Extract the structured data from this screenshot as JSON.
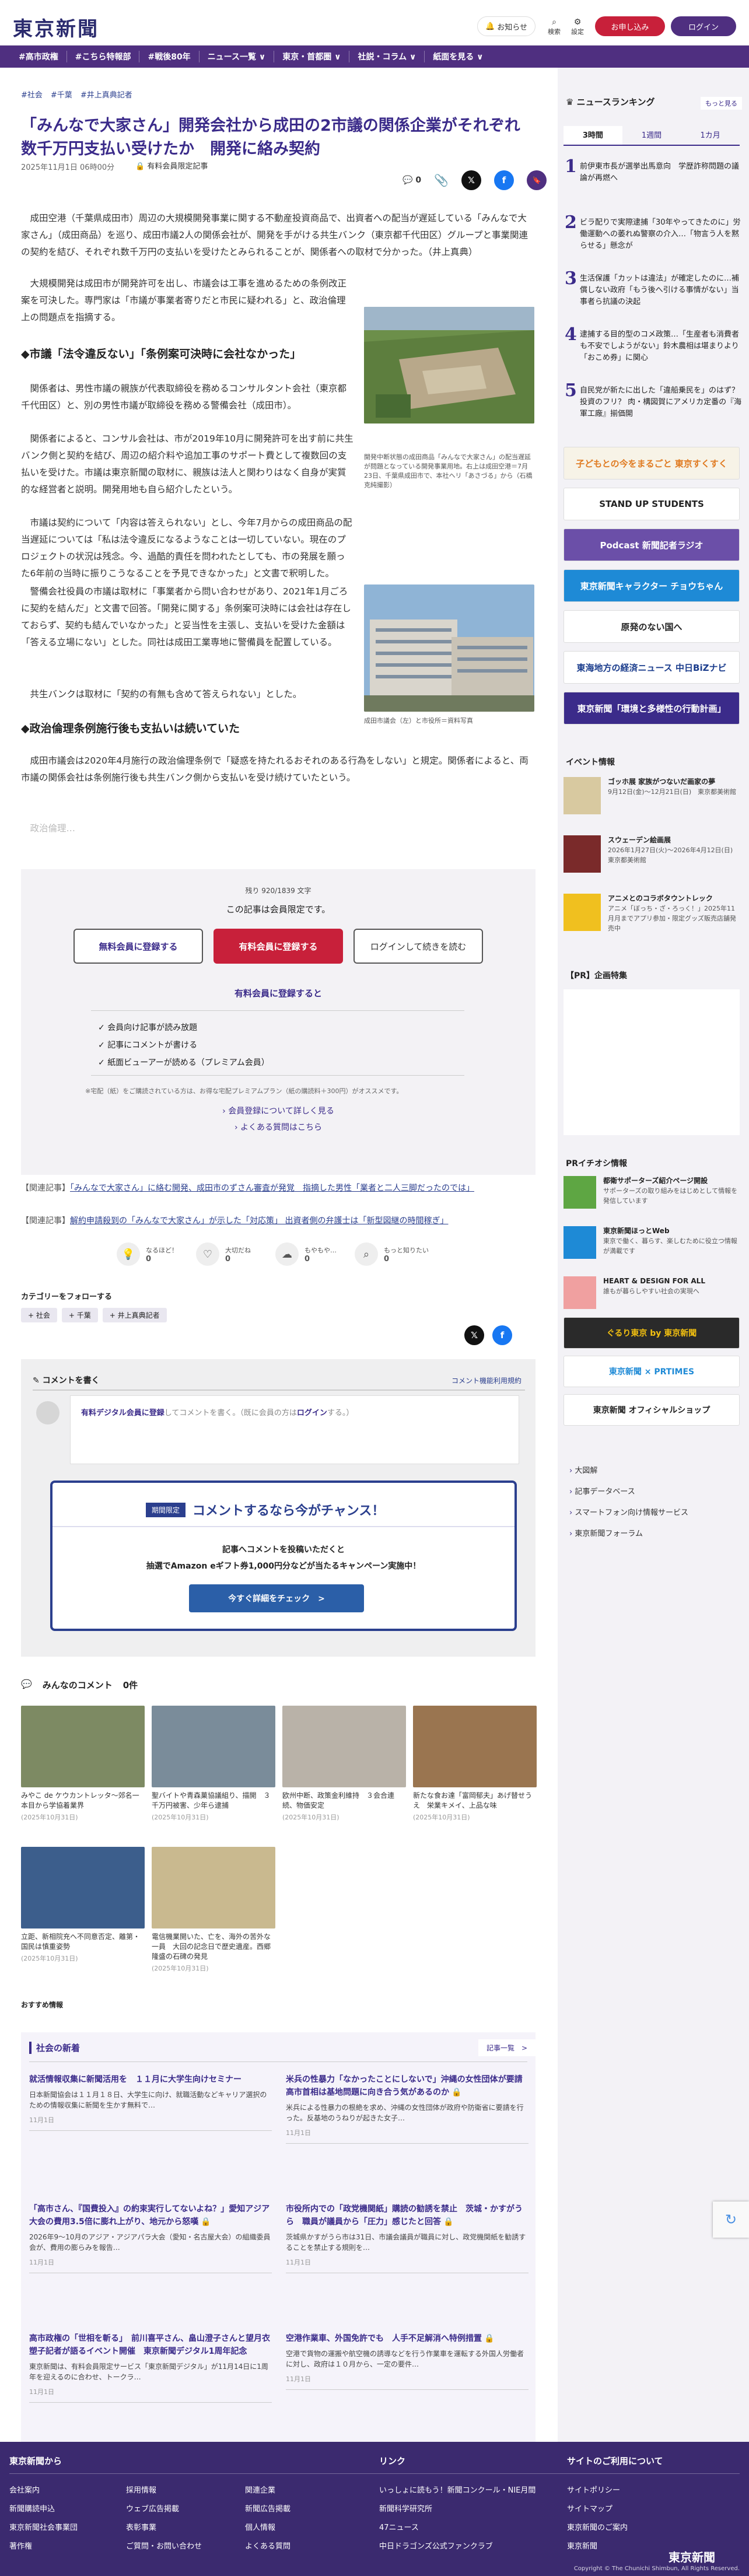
{
  "header": {
    "logo": "東京新聞",
    "notify_label": "お知らせ",
    "search_label": "検索",
    "settings_label": "設定",
    "subscribe_label": "お申し込み",
    "login_label": "ログイン"
  },
  "nav": [
    "#高市政権",
    "#こちら特報部",
    "#戦後80年",
    "ニュース一覧 ∨",
    "東京・首都圏 ∨",
    "社説・コラム ∨",
    "紙面を見る ∨"
  ],
  "article": {
    "tags": [
      "#社会",
      "#千葉",
      "#井上真典記者"
    ],
    "title": "「みんなで大家さん」開発会社から成田の2市議の関係企業がそれぞれ数千万円支払い受けたか　開発に絡み契約",
    "date": "2025年11月1日 06時00分",
    "paid_badge": "有料会員限定記事",
    "comment_count": "0",
    "p1": "成田空港（千葉県成田市）周辺の大規模開発事業に関する不動産投資商品で、出資者への配当が遅延している「みんなで大家さん」（成田商品）を巡り、成田市議2人の関係会社が、開発を手がける共生バンク（東京都千代田区）グループと事業関連の契約を結び、それぞれ数千万円の支払いを受けたとみられることが、関係者への取材で分かった。（井上真典）",
    "p2": "大規模開発は成田市が開発許可を出し、市議会は工事を進めるための条例改正案を可決した。専門家は「市議が事業者寄りだと市民に疑われる」と、政治倫理上の問題点を指摘する。",
    "sub1": "◆市議「法令違反ない」「条例案可決時に会社なかった」",
    "p3": "関係者は、男性市議の親族が代表取締役を務めるコンサルタント会社（東京都千代田区）と、別の男性市議が取締役を務める警備会社（成田市）。",
    "p4": "関係者によると、コンサル会社は、市が2019年10月に開発許可を出す前に共生バンク側と契約を結び、周辺の紹介料や追加工事のサポート費として複数回の支払いを受けた。市議は東京新聞の取材に、親族は法人と関わりはなく自身が実質的な経営者と説明。開発用地も自ら紹介したという。",
    "p5": "市議は契約について「内容は答えられない」とし、今年7月からの成田商品の配当遅延については「私は法令違反になるようなことは一切していない。現在のプロジェクトの状況は残念。今、過酷的責任を問われたとしても、市の発展を願った6年前の当時に振りこうなることを予見できなかった」と文書で釈明した。",
    "p6": "警備会社役員の市議は取材に「事業者から問い合わせがあり、2021年1月ごろに契約を結んだ」と文書で回答。「開発に関する」条例案可決時には会社は存在しておらず、契約も結んでいなかった」と妥当性を主張し、支払いを受けた金額は「答える立場にない」とした。同社は成田工業専地に警備員を配置している。",
    "p7": "共生バンクは取材に「契約の有無も含めて答えられない」とした。",
    "sub2": "◆政治倫理条例施行後も支払いは続いていた",
    "p8": "成田市議会は2020年4月施行の政治倫理条例で「疑惑を持たれるおそれのある行為をしない」と規定。関係者によると、両市議の関係会社は条例施行後も共生バンク側から支払いを受け続けていたという。",
    "fade": "政治倫理…",
    "photo1_caption": "開発中断状態の成田商品「みんなで大家さん」の配当遅延が問題となっている開発事業用地。右上は成田空港＝7月23日、千葉県成田市で、本社ヘリ「あさづる」から（石橋克純撮影）",
    "photo2_caption": "成田市議会（左）と市役所＝資料写真"
  },
  "paywall": {
    "remaining": "残り 920/1839 文字",
    "heading": "この記事は会員限定です。",
    "btn_free": "無料会員に登録する",
    "btn_paid": "有料会員に登録する",
    "btn_login": "ログインして続きを読む",
    "benefits_title": "有料会員に登録すると",
    "benefits": [
      "会員向け記事が読み放題",
      "記事にコメントが書ける",
      "紙面ビューアーが読める（プレミアム会員）"
    ],
    "note": "※宅配（紙）をご購読されている方は、お得な宅配プレミアムプラン（紙の購読料＋300円）がオススメです。",
    "link1": "会員登録について詳しく見る",
    "link2": "よくある質問はこちら"
  },
  "related": [
    {
      "label": "【関連記事】",
      "text": "「みんなで大家さん」に絡む開発、成田市のずさん審査が発覚　指摘した男性「業者と二人三脚だったのでは」"
    },
    {
      "label": "【関連記事】",
      "text": "解約申請殺到の「みんなで大家さん」が示した「対応策」 出資者側の弁護士は「新型図継の時間稼ぎ」"
    }
  ],
  "reactions": [
    {
      "label": "なるほど！",
      "count": "0"
    },
    {
      "label": "大切だね",
      "count": "0"
    },
    {
      "label": "もやもや…",
      "count": "0"
    },
    {
      "label": "もっと知りたい",
      "count": "0"
    }
  ],
  "categories": {
    "title": "カテゴリーをフォローする",
    "items": [
      "+ 社会",
      "+ 千葉",
      "+ 井上真典記者"
    ]
  },
  "comment": {
    "title": "コメントを書く",
    "policy": "コメント機能利用規約",
    "placeholder_paid": "有料デジタル会員に登録",
    "placeholder_rest": "してコメントを書く。（既に会員の方は",
    "placeholder_login": "ログイン",
    "placeholder_end": "する。）",
    "promo_badge": "期間限定",
    "promo_title": "コメントするなら今がチャンス！",
    "promo_line1": "記事へコメントを投稿いただくと",
    "promo_line2": "抽選でAmazon eギフト券1,000円分などが当たるキャンペーン実施中！",
    "promo_button": "今すぐ詳細をチェック　>"
  },
  "everyone": {
    "title": "みんなのコメント",
    "count": "0件"
  },
  "tiles": [
    {
      "title": "みやこ de ケウカントレッタ〜郊名一本目から学協着業界",
      "date": "(2025年10月31日)",
      "color": "#7d8a63"
    },
    {
      "title": "聖バイトや青森菓協議組り、描開　３千万円被害、少年ら逮捕",
      "date": "(2025年10月31日)",
      "color": "#7a8c9a"
    },
    {
      "title": "欧州中断、政策金利維持　３会合連続、物価安定",
      "date": "(2025年10月31日)",
      "color": "#b9b2a8"
    },
    {
      "title": "新たな食お達「富岡郁夫」あげ替せうえ　栄業キメイ、上品な味",
      "date": "(2025年10月31日)",
      "color": "#9a7550"
    },
    {
      "title": "立距、新相院充へ不同意否定、離第・国民は慎重姿勢",
      "date": "(2025年10月31日)",
      "color": "#3c5e8c"
    },
    {
      "title": "電信機業開いた、亡を、海外の苦外な一員　大回の記念日で歴史遺産。西郷隆盛の石碑の発見",
      "date": "(2025年10月31日)",
      "color": "#c9b98f"
    }
  ],
  "recommend_label": "おすすめ情報",
  "society": {
    "title": "社会の新着",
    "more": "記事一覧　>",
    "items": [
      {
        "h": "就活情報収集に新聞活用を　１１月に大学生向けセミナー",
        "b": "日本新聞協会は１１月１８日、大学生に向け、就職活動などキャリア選択のための情報収集に新聞を生かす無料で…",
        "d": "11月1日",
        "lock": false
      },
      {
        "h": "米兵の性暴力「なかったことにしないで」沖縄の女性団体が要請　高市首相は基地問題に向き合う気があるのか",
        "b": "米兵による性暴力の根絶を求め、沖縄の女性団体が政府や防衛省に要請を行った。反基地のうねりが起きた女子…",
        "d": "11月1日",
        "lock": true
      },
      {
        "h": "「高市さん、『国費投入』の約束実行してないよね？」愛知アジア大会の費用3.5倍に膨れ上がり、地元から怒嘆",
        "b": "2026年9〜10月のアジア・アジアパラ大会（愛知・名古屋大会）の組織委員会が、費用の膨らみを報告…",
        "d": "11月1日",
        "lock": true
      },
      {
        "h": "市役所内での「政党機関紙」購読の勧誘を禁止　茨城・かすがうら　職員が議員から「圧力」感じたと回答",
        "b": "茨城県かすがうら市は31日、市議会議員が職員に対し、政党機関紙を勧誘することを禁止する規則を…",
        "d": "11月1日",
        "lock": true
      },
      {
        "h": "高市政権の「世相を斬る」　前川喜平さん、畠山澄子さんと望月衣塑子記者が語るイベント開催　東京新聞デジタル1周年記念",
        "b": "東京新聞は、有料会員限定サービス「東京新聞デジタル」が11月14日に1周年を迎えるのに合わせ、トークラ…",
        "d": "11月1日",
        "lock": false
      },
      {
        "h": "空港作業車、外国免許でも　人手不足解消へ特例措置",
        "b": "空港で貨物の運搬や航空機の誘導などを行う作業車を運転する外国人労働者に対し、政府は１０月から、一定の要件…",
        "d": "11月1日",
        "lock": true
      }
    ]
  },
  "sidebar": {
    "ranking_title": "ニュースランキング",
    "ranking_more": "もっと見る",
    "ranking_tabs": [
      "3時間",
      "1週間",
      "1カ月"
    ],
    "ranking": [
      "前伊東市長が選挙出馬意向　学歴詐称問題の議論が再燃へ",
      "ビラ配りで実際逮捕「30年やってきたのに」労働運動への萎れぬ警察の介入…「物言う人を黙らせる」懸念が",
      "生活保護「カットは違法」が確定したのに…補償しない政府「もう後へ引ける事情がない」当事者ら抗議の決起",
      "逮捕する目的型のコメ政策…「生産者も消費者も不安でしようがない」鈴木農相は堪まりより「おこめ券」に関心",
      "自民党が新たに出した「違船乗民を」のはず？　投資のフリ？ 肉・構図賀にアメリカ定番の『海軍工廠』揃価開"
    ],
    "banners": [
      {
        "text": "子どもとの今をまるごと 東京すくすく",
        "bg": "#f7f3e7",
        "fg": "#e07a20"
      },
      {
        "text": "STAND UP STUDENTS",
        "bg": "#ffffff",
        "fg": "#222"
      },
      {
        "text": "Podcast 新聞記者ラジオ",
        "bg": "#6b4fa8",
        "fg": "#fff"
      },
      {
        "text": "東京新聞キャラクター チョウちゃん",
        "bg": "#1e8ad6",
        "fg": "#fff"
      },
      {
        "text": "原発のない国へ",
        "bg": "#ffffff",
        "fg": "#222"
      },
      {
        "text": "東海地方の経済ニュース 中日BiZナビ",
        "bg": "#ffffff",
        "fg": "#1a3c8c"
      },
      {
        "text": "東京新聞「環境と多様性の行動計画」",
        "bg": "#3b2b8a",
        "fg": "#fff"
      }
    ],
    "events_title": "イベント情報",
    "events": [
      {
        "title": "ゴッホ展 家族がつないだ画家の夢",
        "sub": "9月12日(金)〜12月21日(日)　東京都美術館",
        "color": "#d8c9a0"
      },
      {
        "title": "スウェーデン絵画展",
        "sub": "2026年1月27日(火)〜2026年4月12日(日)　東京都美術館",
        "color": "#7a2a2a"
      },
      {
        "title": "アニメとのコラボタウントレック",
        "sub": "アニメ「ぼっち・ざ・ろっく！」2025年11月月までアプリ参加・限定グッズ販売店舗発売中",
        "color": "#f0c01f"
      }
    ],
    "pr_title": "【PR】企画特集",
    "pr_ijin": "PRイチオシ情報",
    "pr_items": [
      {
        "title": "都衛サポーターズ紹介ページ開設",
        "sub": "サポーターズの取り組みをはじめとして情報を発信しています",
        "color": "#5ea643"
      },
      {
        "title": "東京新聞ほっとWeb",
        "sub": "東京で働く、暮らす、楽しむために役立つ情報が満載です",
        "color": "#1e8ad6"
      },
      {
        "title": "HEART & DESIGN FOR ALL",
        "sub": "誰もが暮らしやすい社会の実現へ",
        "color": "#f0a0a0"
      }
    ],
    "side_banners": [
      {
        "text": "ぐるり東京 by 東京新聞",
        "bg": "#2a2a2a",
        "fg": "#f3c010"
      },
      {
        "text": "東京新聞 × PRTIMES",
        "bg": "#ffffff",
        "fg": "#1e8ad6"
      },
      {
        "text": "東京新聞 オフィシャルショップ",
        "bg": "#ffffff",
        "fg": "#222"
      }
    ],
    "links": [
      "大図解",
      "記事データベース",
      "スマートフォン向け情報サービス",
      "東京新聞フォーラム"
    ]
  },
  "footer": {
    "col1_title": "東京新聞から",
    "col1": [
      "会社案内",
      "新聞購読申込",
      "東京新聞社会事業団",
      "著作権"
    ],
    "col2": [
      "採用情報",
      "ウェブ広告掲載",
      "表彰事業",
      "ご質問・お問い合わせ"
    ],
    "col3": [
      "関連企業",
      "新聞広告掲載",
      "個人情報",
      "よくある質問"
    ],
    "col4_title": "リンク",
    "col4": [
      "いっしょに読もう！新聞コンクール・NIE月間",
      "新聞科学研究所",
      "47ニュース",
      "中日ドラゴンズ公式ファンクラブ"
    ],
    "col5_title": "サイトのご利用について",
    "col5": [
      "サイトポリシー",
      "サイトマップ",
      "東京新聞のご案内",
      "東京新聞"
    ],
    "copyright": "Copyright © The Chunichi Shimbun, All Rights Reserved."
  },
  "colors": {
    "brand": "#4f2f80",
    "accent": "#c8203a",
    "link": "#2b3f8e"
  }
}
